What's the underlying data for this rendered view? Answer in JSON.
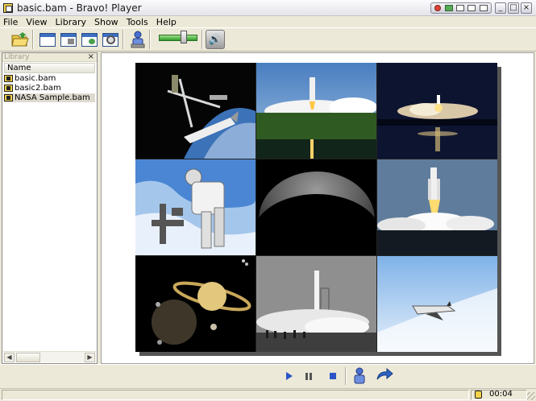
{
  "window": {
    "title": "basic.bam - Bravo! Player"
  },
  "menu": {
    "items": [
      "File",
      "View",
      "Library",
      "Show",
      "Tools",
      "Help"
    ]
  },
  "toolbar": {
    "volume_level": 0.6
  },
  "library": {
    "title": "Library",
    "close_glyph": "×",
    "column_header": "Name",
    "files": [
      {
        "name": "basic.bam",
        "selected": false
      },
      {
        "name": "basic2.bam",
        "selected": false
      },
      {
        "name": "NASA Sample.bam",
        "selected": true
      }
    ]
  },
  "viewer": {
    "images": [
      "space-station-shuttle",
      "shuttle-launch-trees",
      "night-launch",
      "astronaut-spacewalk",
      "moon-crescent",
      "shuttle-launch-day",
      "saturn-planet",
      "rocket-launch-bw",
      "shuttle-glide"
    ]
  },
  "controls": {
    "play_glyph": "play-icon",
    "pause_glyph": "pause-icon",
    "stop_glyph": "stop-icon"
  },
  "status": {
    "time": "00:04"
  }
}
